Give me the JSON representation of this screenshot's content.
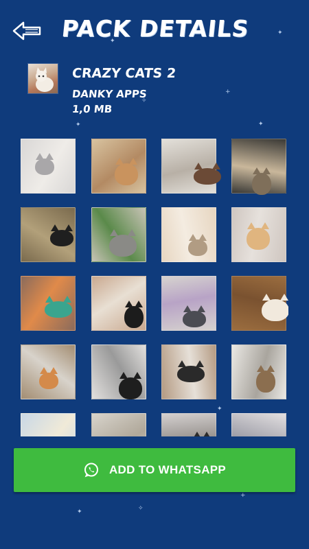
{
  "header": {
    "title": "PACK DETAILS",
    "back_icon": "back-arrow-icon"
  },
  "pack": {
    "name": "CRAZY CATS 2",
    "author": "DANKY APPS",
    "size": "1,0 MB"
  },
  "stickers": [
    {
      "colors": [
        "#d9d7d6",
        "#a9a7a9",
        "#efece8"
      ]
    },
    {
      "colors": [
        "#d8c3a0",
        "#c9935e",
        "#b38a63"
      ]
    },
    {
      "colors": [
        "#e3e0da",
        "#6b4a36",
        "#b8b0a6"
      ]
    },
    {
      "colors": [
        "#3b3a36",
        "#7f6f5a",
        "#c9b79b"
      ]
    },
    {
      "colors": [
        "#7a6a4d",
        "#1f1f1f",
        "#b2a07a"
      ]
    },
    {
      "colors": [
        "#c8c3b6",
        "#8a8a86",
        "#5a8a4a"
      ]
    },
    {
      "colors": [
        "#e7d6c1",
        "#b19c83",
        "#f4ece1"
      ]
    },
    {
      "colors": [
        "#cfc6c0",
        "#e0b57f",
        "#e6e1dc"
      ]
    },
    {
      "colors": [
        "#8a6b5c",
        "#3aa58e",
        "#e08a4a"
      ]
    },
    {
      "colors": [
        "#c9a88f",
        "#1c1c1c",
        "#e8dfd3"
      ]
    },
    {
      "colors": [
        "#d6d3cf",
        "#4b4c53",
        "#b8a3c6"
      ]
    },
    {
      "colors": [
        "#9b6d3f",
        "#f1e9dd",
        "#7a5230"
      ]
    },
    {
      "colors": [
        "#a38d72",
        "#d48a4a",
        "#d8d3cb"
      ]
    },
    {
      "colors": [
        "#e2e0de",
        "#1e1e1e",
        "#9a9a9a"
      ]
    },
    {
      "colors": [
        "#b49a82",
        "#2a2a2a",
        "#e6e0d8"
      ]
    },
    {
      "colors": [
        "#eae8e4",
        "#8b6e4f",
        "#a9a59e"
      ]
    },
    {
      "colors": [
        "#c9d8e6",
        "#8a7a5c",
        "#f0ead8"
      ]
    },
    {
      "colors": [
        "#d8d4cc",
        "#5a5a5a",
        "#b0a89a"
      ]
    },
    {
      "colors": [
        "#d4d0cf",
        "#2b2b2b",
        "#8f8a86"
      ]
    },
    {
      "colors": [
        "#e2dfe0",
        "#c35a6a",
        "#9e9ea8"
      ]
    }
  ],
  "add_button": {
    "label": "ADD TO WHATSAPP",
    "icon": "whatsapp-icon",
    "color": "#3fbb3f"
  },
  "theme": {
    "background": "#0f3b7c"
  }
}
